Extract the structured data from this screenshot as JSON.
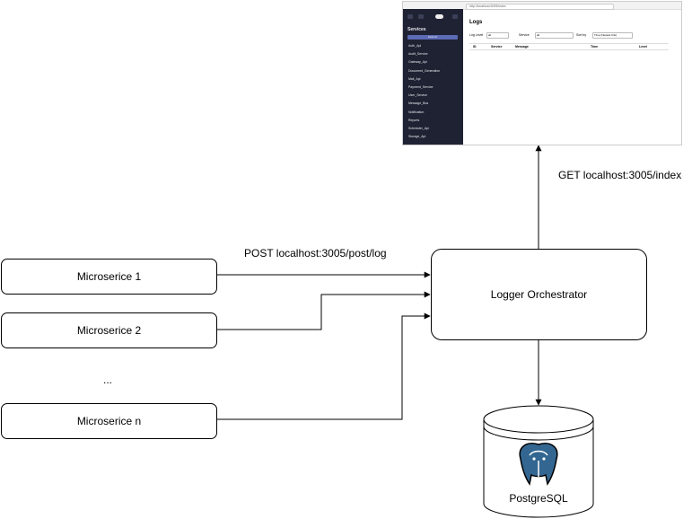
{
  "nodes": {
    "ms1": "Microserice 1",
    "ms2": "Microserice 2",
    "ellipsis": "...",
    "msn": "Microserice n",
    "orchestrator": "Logger Orchestrator",
    "database": "PostgreSQL"
  },
  "edges": {
    "post": "POST localhost:3005/post/log",
    "get": "GET localhost:3005/index"
  },
  "screenshot": {
    "address": "http://localhost:3005/index",
    "sidebar_title": "Services",
    "sidebar_button": "Refresh",
    "sidebar_items": [
      "Auth_Api",
      "Audit_Service",
      "Gateway_Api",
      "Document_Generation",
      "Mail_Api",
      "Payment_Service",
      "User_Service",
      "Message_Bus",
      "Notification",
      "Reports",
      "Scheduler_Api",
      "Storage_Api"
    ],
    "page_title": "Logs",
    "filters": [
      {
        "label": "Log Level",
        "value": "all"
      },
      {
        "label": "Service",
        "value": "all"
      },
      {
        "label": "Sort by",
        "value": "Time (Newest first)"
      }
    ],
    "columns": [
      "ID",
      "Service",
      "Message",
      "Time",
      "Level"
    ]
  }
}
